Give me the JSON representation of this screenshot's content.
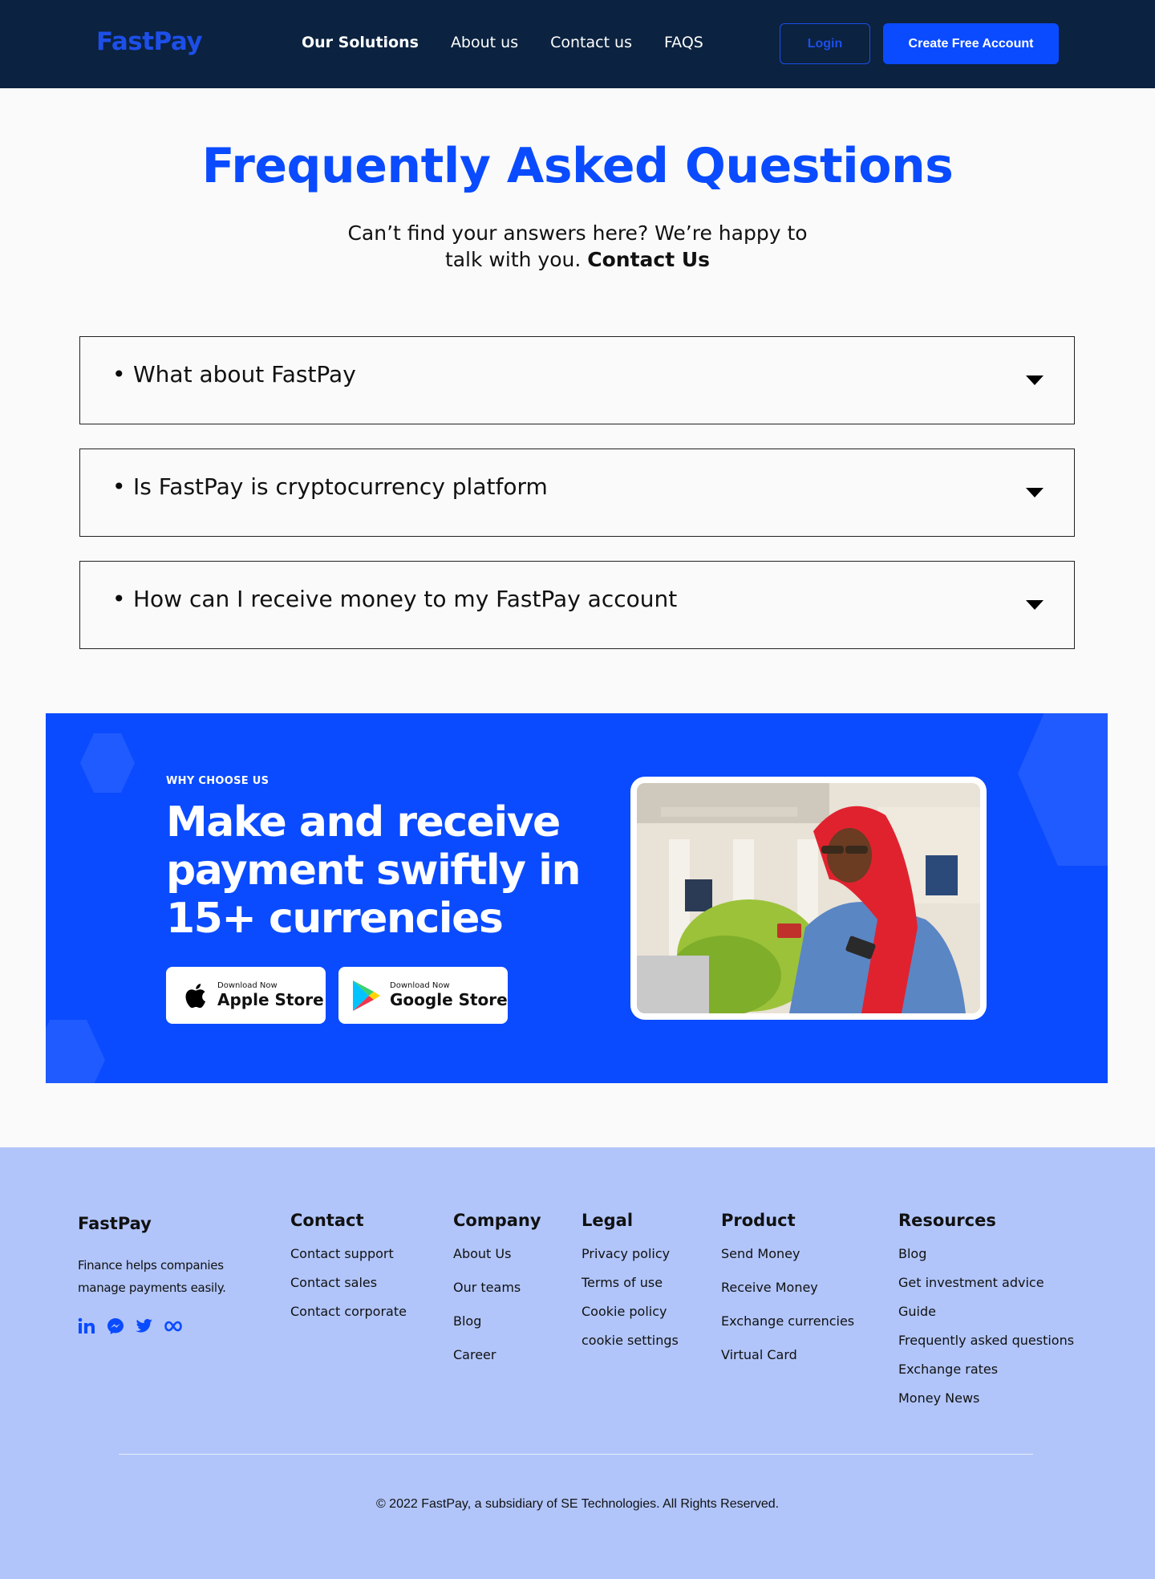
{
  "header": {
    "logo": "FastPay",
    "nav": [
      "Our Solutions",
      "About us",
      "Contact us",
      "FAQS"
    ],
    "login_label": "Login",
    "create_label": "Create Free Account"
  },
  "faq": {
    "title": "Frequently Asked Questions",
    "subtitle": "Can’t find your answers here? We’re happy to talk with you.",
    "contact_link": "Contact Us",
    "questions": [
      "What about FastPay",
      "Is FastPay is cryptocurrency platform",
      "How can I receive money to my FastPay account"
    ]
  },
  "banner": {
    "eyebrow": "WHY CHOOSE US",
    "headline": "Make and receive payment swiftly in  15+ currencies",
    "stores": [
      {
        "small": "Download Now",
        "big": "Apple Store",
        "icon": "apple-icon"
      },
      {
        "small": "Download Now",
        "big": "Google Store",
        "icon": "google-play-icon"
      }
    ]
  },
  "footer": {
    "brand": "FastPay",
    "description": "Finance helps companies manage payments easily.",
    "socials": [
      "linkedin-icon",
      "messenger-icon",
      "twitter-icon",
      "meta-icon"
    ],
    "columns": [
      {
        "title": "Contact",
        "links": [
          "Contact support",
          "Contact sales",
          "Contact corporate"
        ]
      },
      {
        "title": "Company",
        "links": [
          "About Us",
          "Our teams",
          "Blog",
          "Career"
        ]
      },
      {
        "title": "Legal",
        "links": [
          "Privacy policy",
          "Terms of use",
          "Cookie policy",
          "cookie settings"
        ]
      },
      {
        "title": "Product",
        "links": [
          "Send Money",
          "Receive Money",
          "Exchange currencies",
          "Virtual Card"
        ]
      },
      {
        "title": "Resources",
        "links": [
          "Blog",
          "Get investment advice",
          "Guide",
          "Frequently asked questions",
          "Exchange rates",
          "Money News"
        ]
      }
    ],
    "copyright": "© 2022 FastPay, a subsidiary of SE Technologies. All Rights Reserved."
  },
  "colors": {
    "header_bg": "#0b2240",
    "primary": "#0a4bff",
    "footer_bg": "#b1c5fa"
  }
}
